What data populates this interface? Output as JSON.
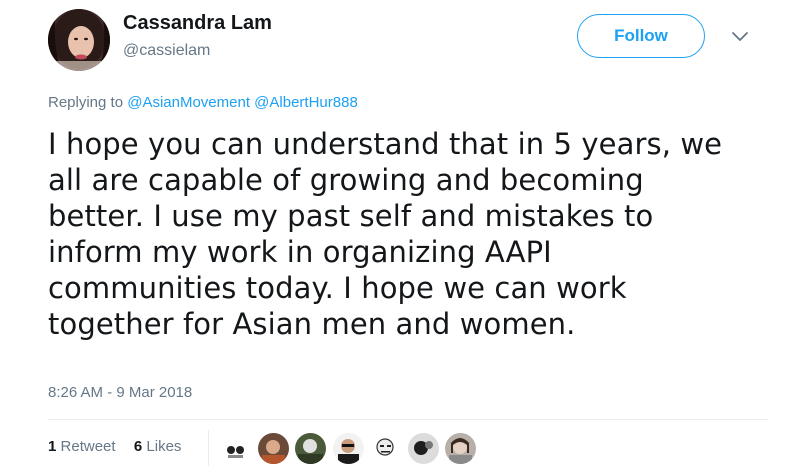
{
  "author": {
    "display_name": "Cassandra Lam",
    "handle": "@cassielam"
  },
  "header": {
    "follow_label": "Follow",
    "menu_icon": "chevron-down-icon"
  },
  "reply": {
    "prefix": "Replying to",
    "mentions": [
      "@AsianMovement",
      "@AlbertHur888"
    ]
  },
  "tweet": {
    "text": "I hope you can understand that in 5 years, we\nall are capable of growing and becoming\nbetter. I use my past self and mistakes to\ninform my work in organizing AAPI\ncommunities today. I hope we can work\ntogether for Asian men and women.",
    "timestamp": "8:26 AM - 9 Mar 2018"
  },
  "stats": {
    "retweets_count": "1",
    "retweets_label": "Retweet",
    "likes_count": "6",
    "likes_label": "Likes"
  },
  "likers": {
    "count": 7,
    "avatars": [
      "liker-avatar-1",
      "liker-avatar-2",
      "liker-avatar-3",
      "liker-avatar-4",
      "liker-avatar-5",
      "liker-avatar-6",
      "liker-avatar-7"
    ]
  },
  "colors": {
    "accent": "#1da1f2",
    "text_primary": "#14171a",
    "text_secondary": "#657786",
    "divider": "#e6ecf0"
  }
}
